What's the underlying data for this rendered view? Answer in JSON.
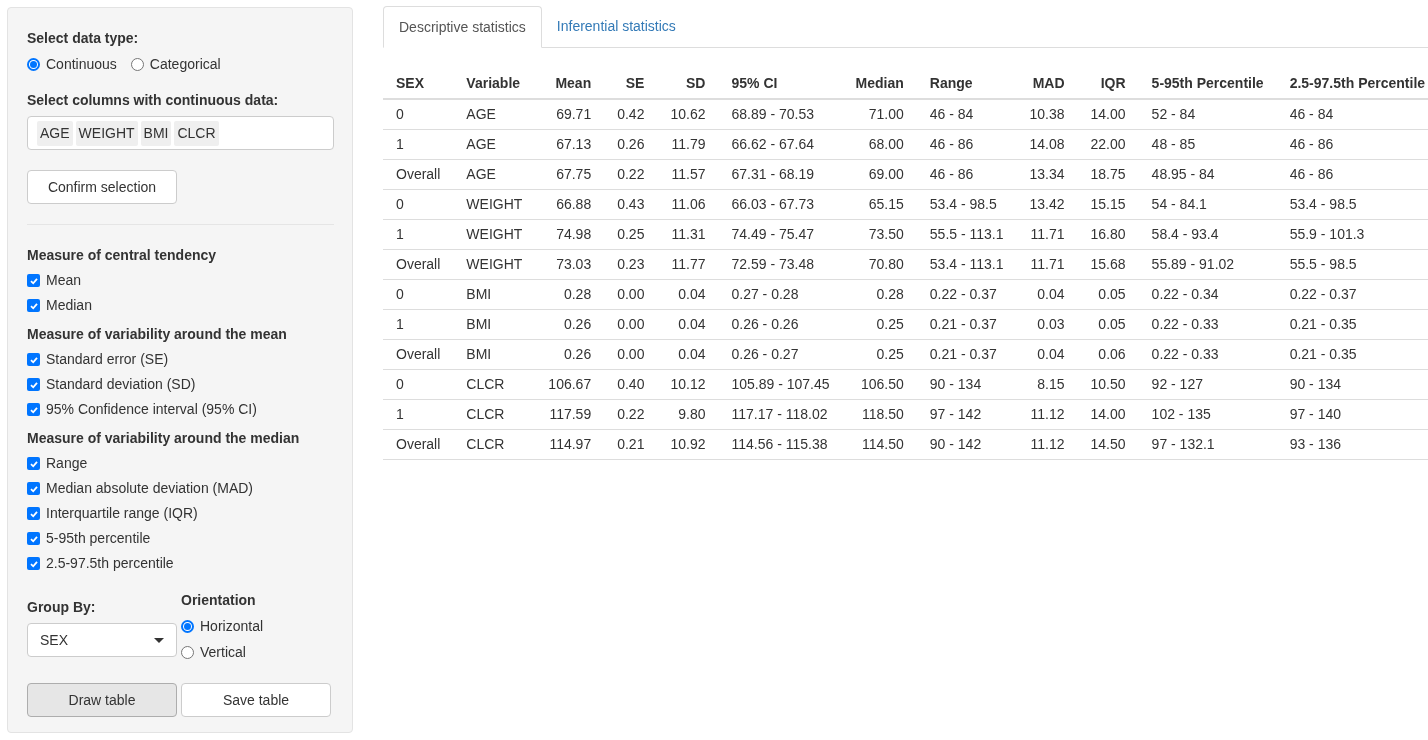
{
  "sidebar": {
    "data_type": {
      "label": "Select data type:",
      "options": [
        {
          "label": "Continuous",
          "selected": true
        },
        {
          "label": "Categorical",
          "selected": false
        }
      ]
    },
    "columns": {
      "label": "Select columns with continuous data:",
      "tags": [
        "AGE",
        "WEIGHT",
        "BMI",
        "CLCR"
      ]
    },
    "confirm_button": "Confirm selection",
    "sections": [
      {
        "title": "Measure of central tendency",
        "items": [
          {
            "label": "Mean",
            "checked": true
          },
          {
            "label": "Median",
            "checked": true
          }
        ]
      },
      {
        "title": "Measure of variability around the mean",
        "items": [
          {
            "label": "Standard error (SE)",
            "checked": true
          },
          {
            "label": "Standard deviation (SD)",
            "checked": true
          },
          {
            "label": "95% Confidence interval (95% CI)",
            "checked": true
          }
        ]
      },
      {
        "title": "Measure of variability around the median",
        "items": [
          {
            "label": "Range",
            "checked": true
          },
          {
            "label": "Median absolute deviation (MAD)",
            "checked": true
          },
          {
            "label": "Interquartile range (IQR)",
            "checked": true
          },
          {
            "label": "5-95th percentile",
            "checked": true
          },
          {
            "label": "2.5-97.5th percentile",
            "checked": true
          }
        ]
      }
    ],
    "group_by": {
      "label": "Group By:",
      "value": "SEX"
    },
    "orientation": {
      "label": "Orientation",
      "options": [
        {
          "label": "Horizontal",
          "selected": true
        },
        {
          "label": "Vertical",
          "selected": false
        }
      ]
    },
    "buttons": [
      {
        "label": "Draw table",
        "pressed": true
      },
      {
        "label": "Save table",
        "pressed": false
      }
    ]
  },
  "tabs": [
    {
      "label": "Descriptive statistics",
      "selected": true
    },
    {
      "label": "Inferential statistics",
      "selected": false
    }
  ],
  "table": {
    "columns": [
      "SEX",
      "Variable",
      "Mean",
      "SE",
      "SD",
      "95% CI",
      "Median",
      "Range",
      "MAD",
      "IQR",
      "5-95th Percentile",
      "2.5-97.5th Percentile"
    ],
    "rows": [
      [
        "0",
        "AGE",
        "69.71",
        "0.42",
        "10.62",
        "68.89 - 70.53",
        "71.00",
        "46 - 84",
        "10.38",
        "14.00",
        "52 - 84",
        "46 - 84"
      ],
      [
        "1",
        "AGE",
        "67.13",
        "0.26",
        "11.79",
        "66.62 - 67.64",
        "68.00",
        "46 - 86",
        "14.08",
        "22.00",
        "48 - 85",
        "46 - 86"
      ],
      [
        "Overall",
        "AGE",
        "67.75",
        "0.22",
        "11.57",
        "67.31 - 68.19",
        "69.00",
        "46 - 86",
        "13.34",
        "18.75",
        "48.95 - 84",
        "46 - 86"
      ],
      [
        "0",
        "WEIGHT",
        "66.88",
        "0.43",
        "11.06",
        "66.03 - 67.73",
        "65.15",
        "53.4 - 98.5",
        "13.42",
        "15.15",
        "54 - 84.1",
        "53.4 - 98.5"
      ],
      [
        "1",
        "WEIGHT",
        "74.98",
        "0.25",
        "11.31",
        "74.49 - 75.47",
        "73.50",
        "55.5 - 113.1",
        "11.71",
        "16.80",
        "58.4 - 93.4",
        "55.9 - 101.3"
      ],
      [
        "Overall",
        "WEIGHT",
        "73.03",
        "0.23",
        "11.77",
        "72.59 - 73.48",
        "70.80",
        "53.4 - 113.1",
        "11.71",
        "15.68",
        "55.89 - 91.02",
        "55.5 - 98.5"
      ],
      [
        "0",
        "BMI",
        "0.28",
        "0.00",
        "0.04",
        "0.27 - 0.28",
        "0.28",
        "0.22 - 0.37",
        "0.04",
        "0.05",
        "0.22 - 0.34",
        "0.22 - 0.37"
      ],
      [
        "1",
        "BMI",
        "0.26",
        "0.00",
        "0.04",
        "0.26 - 0.26",
        "0.25",
        "0.21 - 0.37",
        "0.03",
        "0.05",
        "0.22 - 0.33",
        "0.21 - 0.35"
      ],
      [
        "Overall",
        "BMI",
        "0.26",
        "0.00",
        "0.04",
        "0.26 - 0.27",
        "0.25",
        "0.21 - 0.37",
        "0.04",
        "0.06",
        "0.22 - 0.33",
        "0.21 - 0.35"
      ],
      [
        "0",
        "CLCR",
        "106.67",
        "0.40",
        "10.12",
        "105.89 - 107.45",
        "106.50",
        "90 - 134",
        "8.15",
        "10.50",
        "92 - 127",
        "90 - 134"
      ],
      [
        "1",
        "CLCR",
        "117.59",
        "0.22",
        "9.80",
        "117.17 - 118.02",
        "118.50",
        "97 - 142",
        "11.12",
        "14.00",
        "102 - 135",
        "97 - 140"
      ],
      [
        "Overall",
        "CLCR",
        "114.97",
        "0.21",
        "10.92",
        "114.56 - 115.38",
        "114.50",
        "90 - 142",
        "11.12",
        "14.50",
        "97 - 132.1",
        "93 - 136"
      ]
    ]
  }
}
